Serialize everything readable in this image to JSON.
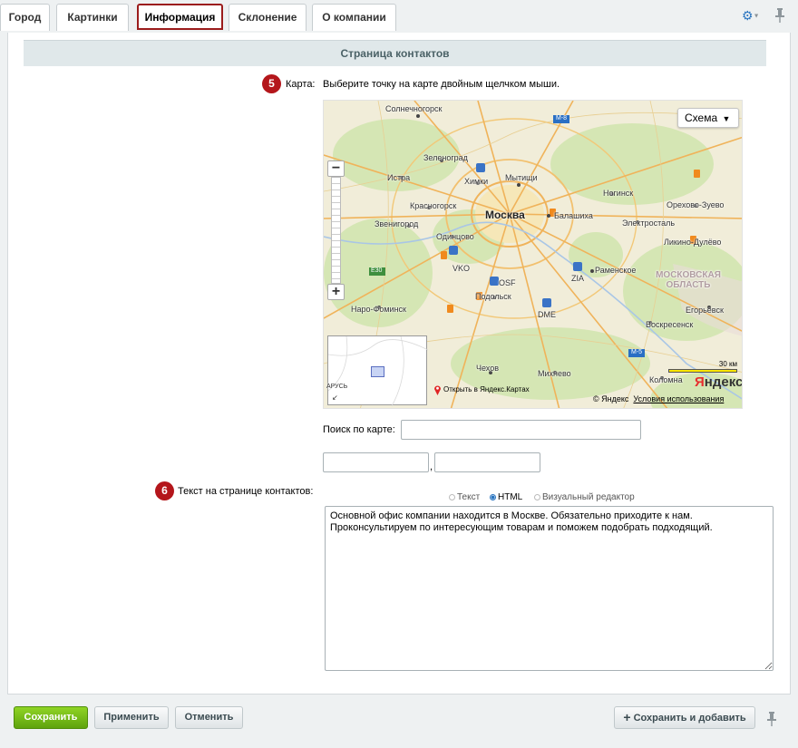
{
  "tabs": [
    {
      "label": "Город"
    },
    {
      "label": "Картинки"
    },
    {
      "label": "Информация",
      "active": true
    },
    {
      "label": "Склонение"
    },
    {
      "label": "О компании"
    }
  ],
  "section_title": "Страница контактов",
  "map_field": {
    "badge": "5",
    "label": "Карта:",
    "hint": "Выберите точку на карте двойным щелчком мыши.",
    "schema_button": "Схема",
    "places": {
      "moscow": "Москва",
      "solnechnogorsk": "Солнечногорск",
      "zelenograd": "Зеленоград",
      "khimki": "Химки",
      "mytishchi": "Мытищи",
      "istra": "Истра",
      "krasnogorsk": "Красногорск",
      "noginsk": "Ногинск",
      "orekhovo": "Орехово-Зуево",
      "zvenigorod": "Звенигород",
      "balashikha": "Балашиха",
      "elektrostal": "Электросталь",
      "odintsovo": "Одинцово",
      "likino": "Ликино-Дулёво",
      "vko": "VKO",
      "ramenskoe": "Раменское",
      "zia": "ZIA",
      "region": "МОСКОВСКАЯ ОБЛАСТЬ",
      "osf": "OSF",
      "podolsk": "Подольск",
      "naro": "Наро-Фоминск",
      "dme": "DME",
      "egorievsk": "Егорьевск",
      "voskresensk": "Воскресенск",
      "chekhov": "Чехов",
      "mikhnevo": "Михнево",
      "kolomna": "Коломна",
      "e30": "E30",
      "m8": "M-8",
      "m5": "M-5",
      "minimap_text": "АРУСЬ"
    },
    "scale": "30 км",
    "logo": "Яндекс",
    "open_link": "Открыть в Яндекс.Картах",
    "copyright": "© Яндекс",
    "terms": "Условия использования"
  },
  "search": {
    "label": "Поиск по карте:",
    "value": ""
  },
  "coords": {
    "lat": "",
    "separator": ",",
    "lng": ""
  },
  "text_field": {
    "badge": "6",
    "label": "Текст на странице контактов:",
    "modes": [
      "Текст",
      "HTML",
      "Визуальный редактор"
    ],
    "selected_mode": "HTML",
    "content": "Основной офис компании находится в Москве. Обязательно приходите к нам.\nПроконсультируем по интересующим товарам и поможем подобрать подходящий."
  },
  "footer": {
    "save": "Сохранить",
    "apply": "Применить",
    "cancel": "Отменить",
    "save_add": "Сохранить и добавить"
  },
  "colors": {
    "active_tab_border": "#9b1c1c",
    "badge": "#b4161b",
    "save_button": "#6cb51a",
    "accent": "#2a75c0"
  }
}
